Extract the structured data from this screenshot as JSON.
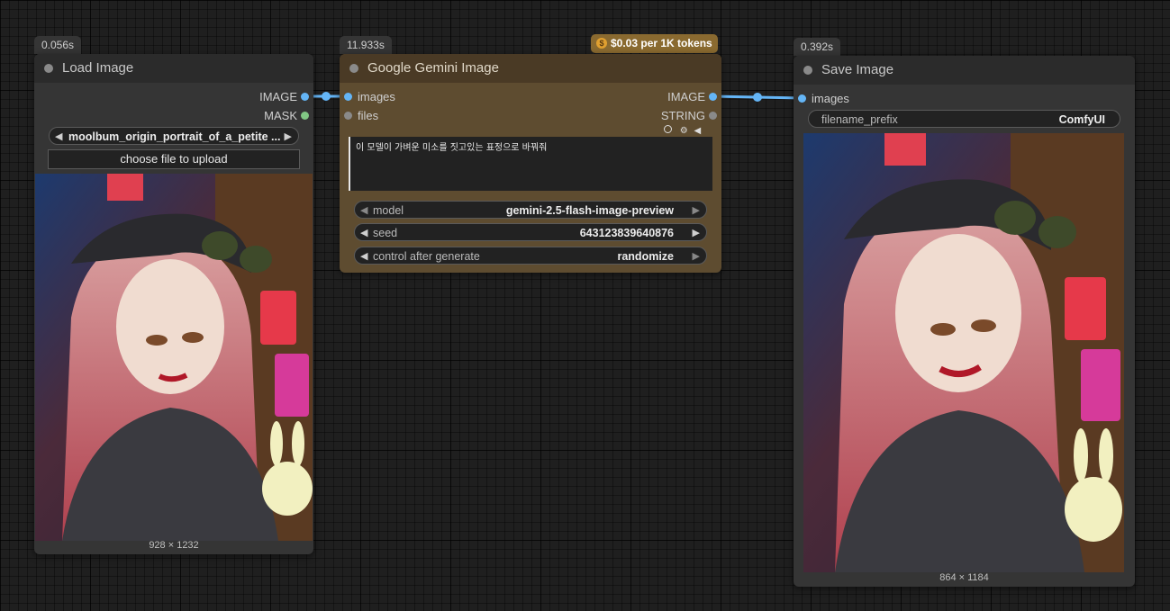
{
  "load_image": {
    "timing": "0.056s",
    "title": "Load Image",
    "outputs": [
      "IMAGE",
      "MASK"
    ],
    "image_select": "moolbum_origin_portrait_of_a_petite ...",
    "upload_button": "choose file to upload",
    "dims": "928 × 1232"
  },
  "gemini": {
    "timing": "11.933s",
    "price_badge": "$0.03 per 1K tokens",
    "title": "Google Gemini Image",
    "inputs": [
      "images",
      "files"
    ],
    "outputs": [
      "IMAGE",
      "STRING"
    ],
    "prompt": "이 모델이 가벼운 미소를 짓고있는 표정으로 바꿔줘",
    "model_label": "model",
    "model_value": "gemini-2.5-flash-image-preview",
    "seed_label": "seed",
    "seed_value": "643123839640876",
    "control_label": "control after generate",
    "control_value": "randomize"
  },
  "save_image": {
    "timing": "0.392s",
    "title": "Save Image",
    "inputs": [
      "images"
    ],
    "prefix_label": "filename_prefix",
    "prefix_value": "ComfyUI",
    "dims": "864 × 1184"
  },
  "colors": {
    "image_link": "#64b5f6",
    "mask_slot": "#81c784",
    "gemini_body": "#5e4c30",
    "price_badge": "#8a6a30"
  },
  "icons": [
    "coin-icon",
    "circle-icon",
    "gear-icon",
    "speaker-icon"
  ]
}
